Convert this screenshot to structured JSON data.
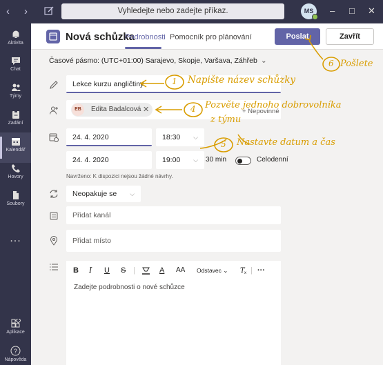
{
  "titlebar": {
    "back_icon": "chevron-left-icon",
    "forward_icon": "chevron-right-icon",
    "compose_icon": "compose-icon",
    "search_placeholder": "Vyhledejte nebo zadejte příkaz.",
    "avatar_initials": "MS",
    "window_controls": [
      "minimize-icon",
      "maximize-icon",
      "close-icon"
    ]
  },
  "rail": {
    "items": [
      {
        "label": "Aktivita",
        "icon": "bell-icon"
      },
      {
        "label": "Chat",
        "icon": "chat-icon"
      },
      {
        "label": "Týmy",
        "icon": "teams-icon"
      },
      {
        "label": "Zadání",
        "icon": "assignments-icon"
      },
      {
        "label": "Kalendář",
        "icon": "calendar-icon",
        "active": true
      },
      {
        "label": "Hovory",
        "icon": "phone-icon"
      },
      {
        "label": "Soubory",
        "icon": "files-icon"
      }
    ],
    "more": "...",
    "apps_label": "Aplikace",
    "help_label": "Nápověda"
  },
  "header": {
    "title": "Nová schůzka",
    "tabs": [
      "Podrobnosti",
      "Pomocník pro plánování"
    ],
    "active_tab": "Podrobnosti",
    "send_label": "Poslat",
    "close_label": "Zavřít"
  },
  "form": {
    "timezone": "Časové pásmo: (UTC+01:00) Sarajevo, Skopje, Varšava, Záhřeb",
    "title_value": "Lekce kurzu angličtiny",
    "attendee": {
      "initials": "EB",
      "name": "Edita Badalcová"
    },
    "optional_label": "+ Nepovinné",
    "start_date": "24. 4. 2020",
    "start_time": "18:30",
    "end_date": "24. 4. 2020",
    "end_time": "19:00",
    "duration": "30 min",
    "all_day_label": "Celodenní",
    "all_day_on": false,
    "suggestions": "Navrženo: K dispozici nejsou žádné návrhy.",
    "repeat_value": "Neopakuje se",
    "channel_placeholder": "Přidat kanál",
    "location_placeholder": "Přidat místo",
    "toolbar": {
      "bold": "B",
      "italic": "I",
      "underline": "U",
      "strike": "S",
      "font_color": "A",
      "font_size": "AA",
      "paragraph": "Odstavec",
      "more": "···"
    },
    "details_placeholder": "Zadejte podrobnosti o nové schůzce"
  },
  "annotations": [
    {
      "num": "1",
      "text": "Napište název schůzky"
    },
    {
      "num": "4",
      "text": "Pozvěte jednoho dobrovolníka",
      "text2": "z týmu"
    },
    {
      "num": "5",
      "text": "Nastavte datum a čas"
    },
    {
      "num": "6",
      "text": "Pošlete"
    }
  ],
  "colors": {
    "brand": "#6264a7",
    "rail": "#33344a",
    "annotation": "#d99d00"
  }
}
